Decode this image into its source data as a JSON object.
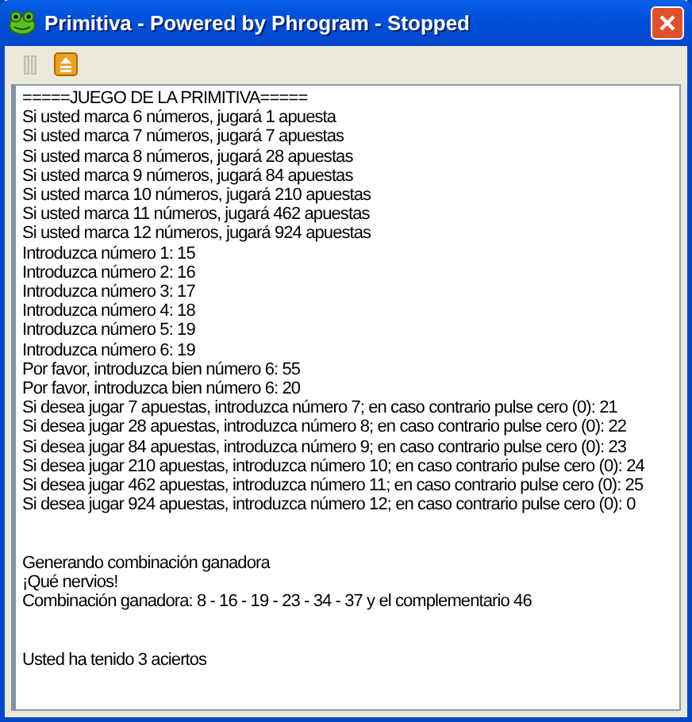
{
  "window": {
    "title": "Primitiva - Powered by Phrogram - Stopped"
  },
  "toolbar": {
    "buttons": [
      {
        "kind": "pause",
        "disabled": true
      },
      {
        "kind": "stop",
        "disabled": false
      }
    ]
  },
  "output": {
    "blocks": [
      [
        "=====JUEGO DE LA PRIMITIVA=====",
        "Si usted marca 6 números, jugará 1 apuesta",
        "Si usted marca 7 números, jugará 7 apuestas",
        "Si usted marca 8 números, jugará 28 apuestas",
        "Si usted marca 9 números, jugará 84 apuestas",
        "Si usted marca 10 números, jugará 210 apuestas",
        "Si usted marca 11 números, jugará 462 apuestas",
        "Si usted marca 12 números, jugará 924 apuestas",
        "Introduzca número 1: 15",
        "Introduzca número 2: 16",
        "Introduzca número 3: 17",
        "Introduzca número 4: 18",
        "Introduzca número 5: 19",
        "Introduzca número 6: 19",
        "Por favor, introduzca bien número 6: 55",
        "Por favor, introduzca bien número 6: 20",
        "Si desea jugar 7 apuestas, introduzca número 7; en caso contrario pulse cero (0): 21",
        "Si desea jugar 28 apuestas, introduzca número 8; en caso contrario pulse cero (0): 22",
        "Si desea jugar 84 apuestas, introduzca número 9; en caso contrario pulse cero (0): 23",
        "Si desea jugar 210 apuestas, introduzca número 10; en caso contrario pulse cero (0): 24",
        "Si desea jugar 462 apuestas, introduzca número 11; en caso contrario pulse cero (0): 25",
        "Si desea jugar 924 apuestas, introduzca número 12; en caso contrario pulse cero (0): 0"
      ],
      [
        "Generando combinación ganadora",
        "¡Qué nervios!",
        "Combinación ganadora: 8 - 16 - 19 - 23 - 34 - 37 y el complementario 46"
      ],
      [
        "Usted ha tenido 3 aciertos"
      ]
    ]
  }
}
